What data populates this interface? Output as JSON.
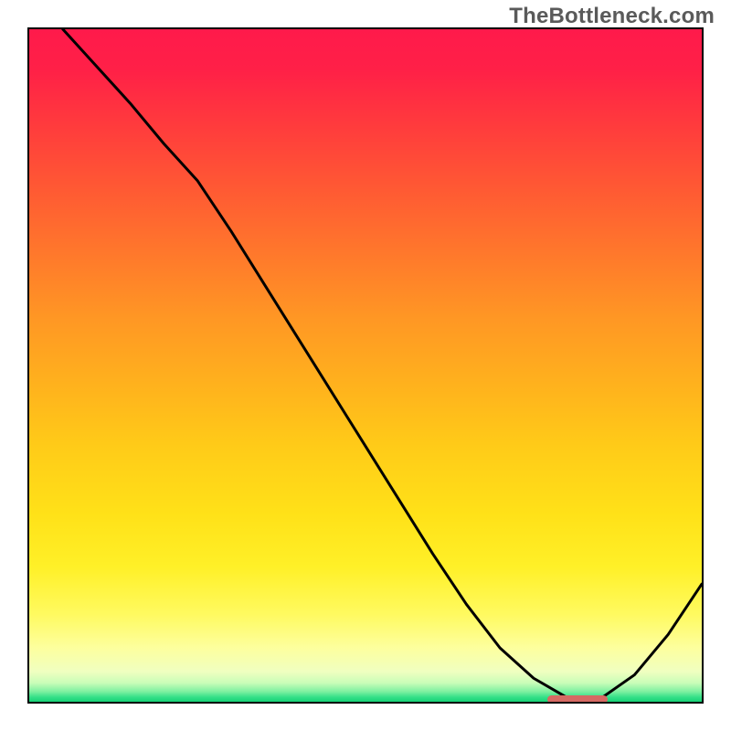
{
  "watermark": "TheBottleneck.com",
  "colors": {
    "gradient_stops": [
      {
        "offset": 0.0,
        "color": "#ff1a4b"
      },
      {
        "offset": 0.06,
        "color": "#ff2047"
      },
      {
        "offset": 0.14,
        "color": "#ff3a3d"
      },
      {
        "offset": 0.24,
        "color": "#ff5a33"
      },
      {
        "offset": 0.34,
        "color": "#ff7a2b"
      },
      {
        "offset": 0.43,
        "color": "#ff9724"
      },
      {
        "offset": 0.53,
        "color": "#ffb21d"
      },
      {
        "offset": 0.62,
        "color": "#ffcb18"
      },
      {
        "offset": 0.72,
        "color": "#ffe118"
      },
      {
        "offset": 0.8,
        "color": "#fff028"
      },
      {
        "offset": 0.87,
        "color": "#fffa60"
      },
      {
        "offset": 0.92,
        "color": "#fdff9e"
      },
      {
        "offset": 0.955,
        "color": "#f0ffc0"
      },
      {
        "offset": 0.972,
        "color": "#c9fdb8"
      },
      {
        "offset": 0.985,
        "color": "#7df0a0"
      },
      {
        "offset": 0.993,
        "color": "#36e089"
      },
      {
        "offset": 1.0,
        "color": "#17d276"
      }
    ],
    "line": "#000000",
    "marker": "#d66a63",
    "border": "#000000"
  },
  "chart_data": {
    "type": "line",
    "title": "",
    "xlabel": "",
    "ylabel": "",
    "x_range": [
      0,
      100
    ],
    "y_range": [
      0,
      100
    ],
    "x": [
      5,
      10,
      15,
      20,
      25,
      30,
      35,
      40,
      45,
      50,
      55,
      60,
      65,
      70,
      75,
      80,
      82,
      85,
      90,
      95,
      100
    ],
    "values": [
      100,
      94.5,
      89,
      83,
      77.5,
      70,
      62,
      54,
      46,
      38,
      30,
      22,
      14.5,
      8,
      3.5,
      0.6,
      0,
      0.5,
      4,
      10,
      17.5
    ],
    "optimum_marker": {
      "x_start": 77,
      "x_end": 86,
      "y": 0.3
    },
    "grid": false,
    "legend": false
  }
}
